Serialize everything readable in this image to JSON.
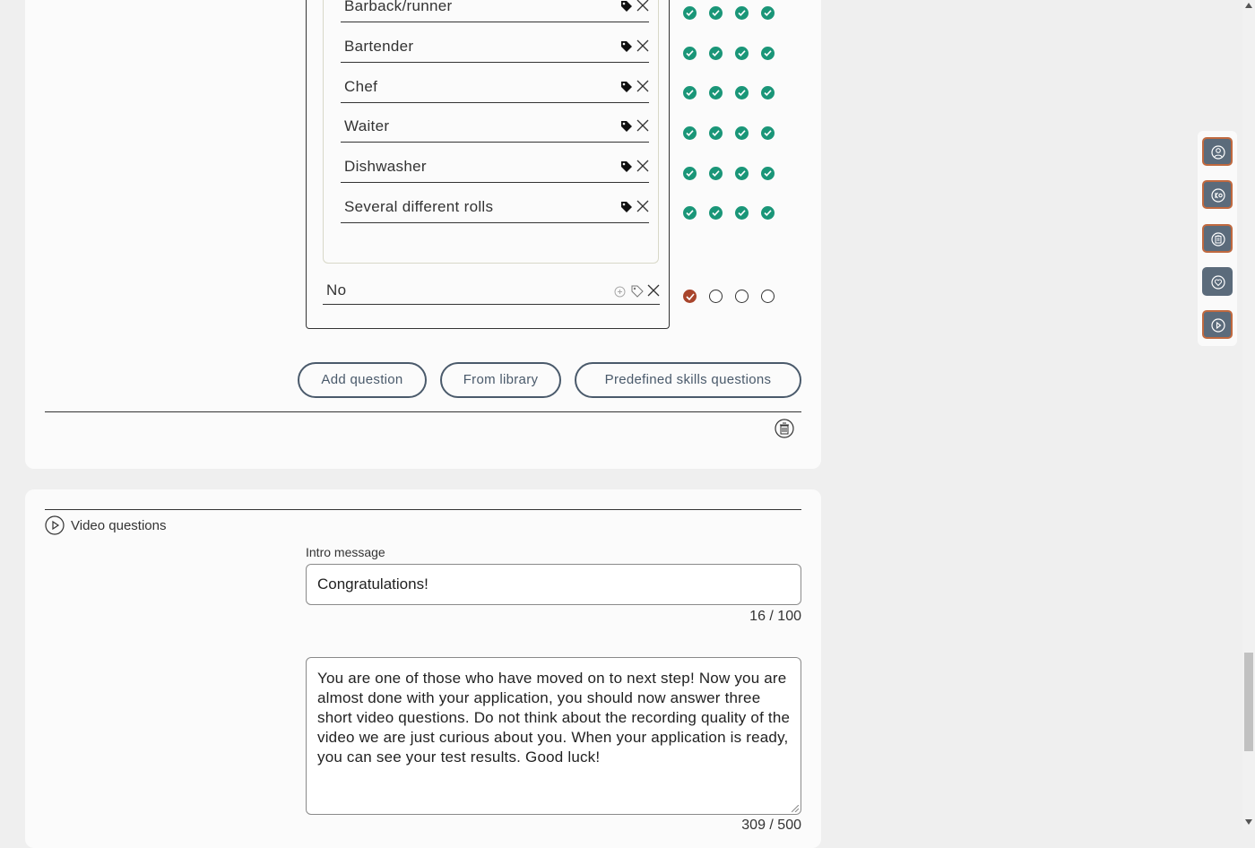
{
  "answers": [
    {
      "label": "Barback/runner"
    },
    {
      "label": "Bartender"
    },
    {
      "label": "Chef"
    },
    {
      "label": "Waiter"
    },
    {
      "label": "Dishwasher"
    },
    {
      "label": "Several different rolls"
    }
  ],
  "no_option": {
    "label": "No"
  },
  "buttons": {
    "add_question": "Add question",
    "from_library": "From library",
    "predefined": "Predefined skills questions"
  },
  "video_section": {
    "title": "Video questions",
    "intro_label": "Intro message",
    "intro_value": "Congratulations!",
    "intro_counter": "16 / 100",
    "message_value": "You are one of those who have moved on to next step! Now you are almost done with your application, you should now answer three short video questions. Do not think about the recording quality of the video we are just curious about you. When your application is ready, you can see your test results. Good luck!",
    "message_counter": "309 / 500"
  },
  "colors": {
    "check_green": "#1a9678",
    "selected_radio": "#a8452c",
    "button_text": "#4a5a6b",
    "side_button": "#5b6b7b",
    "side_border": "#c0693f"
  }
}
